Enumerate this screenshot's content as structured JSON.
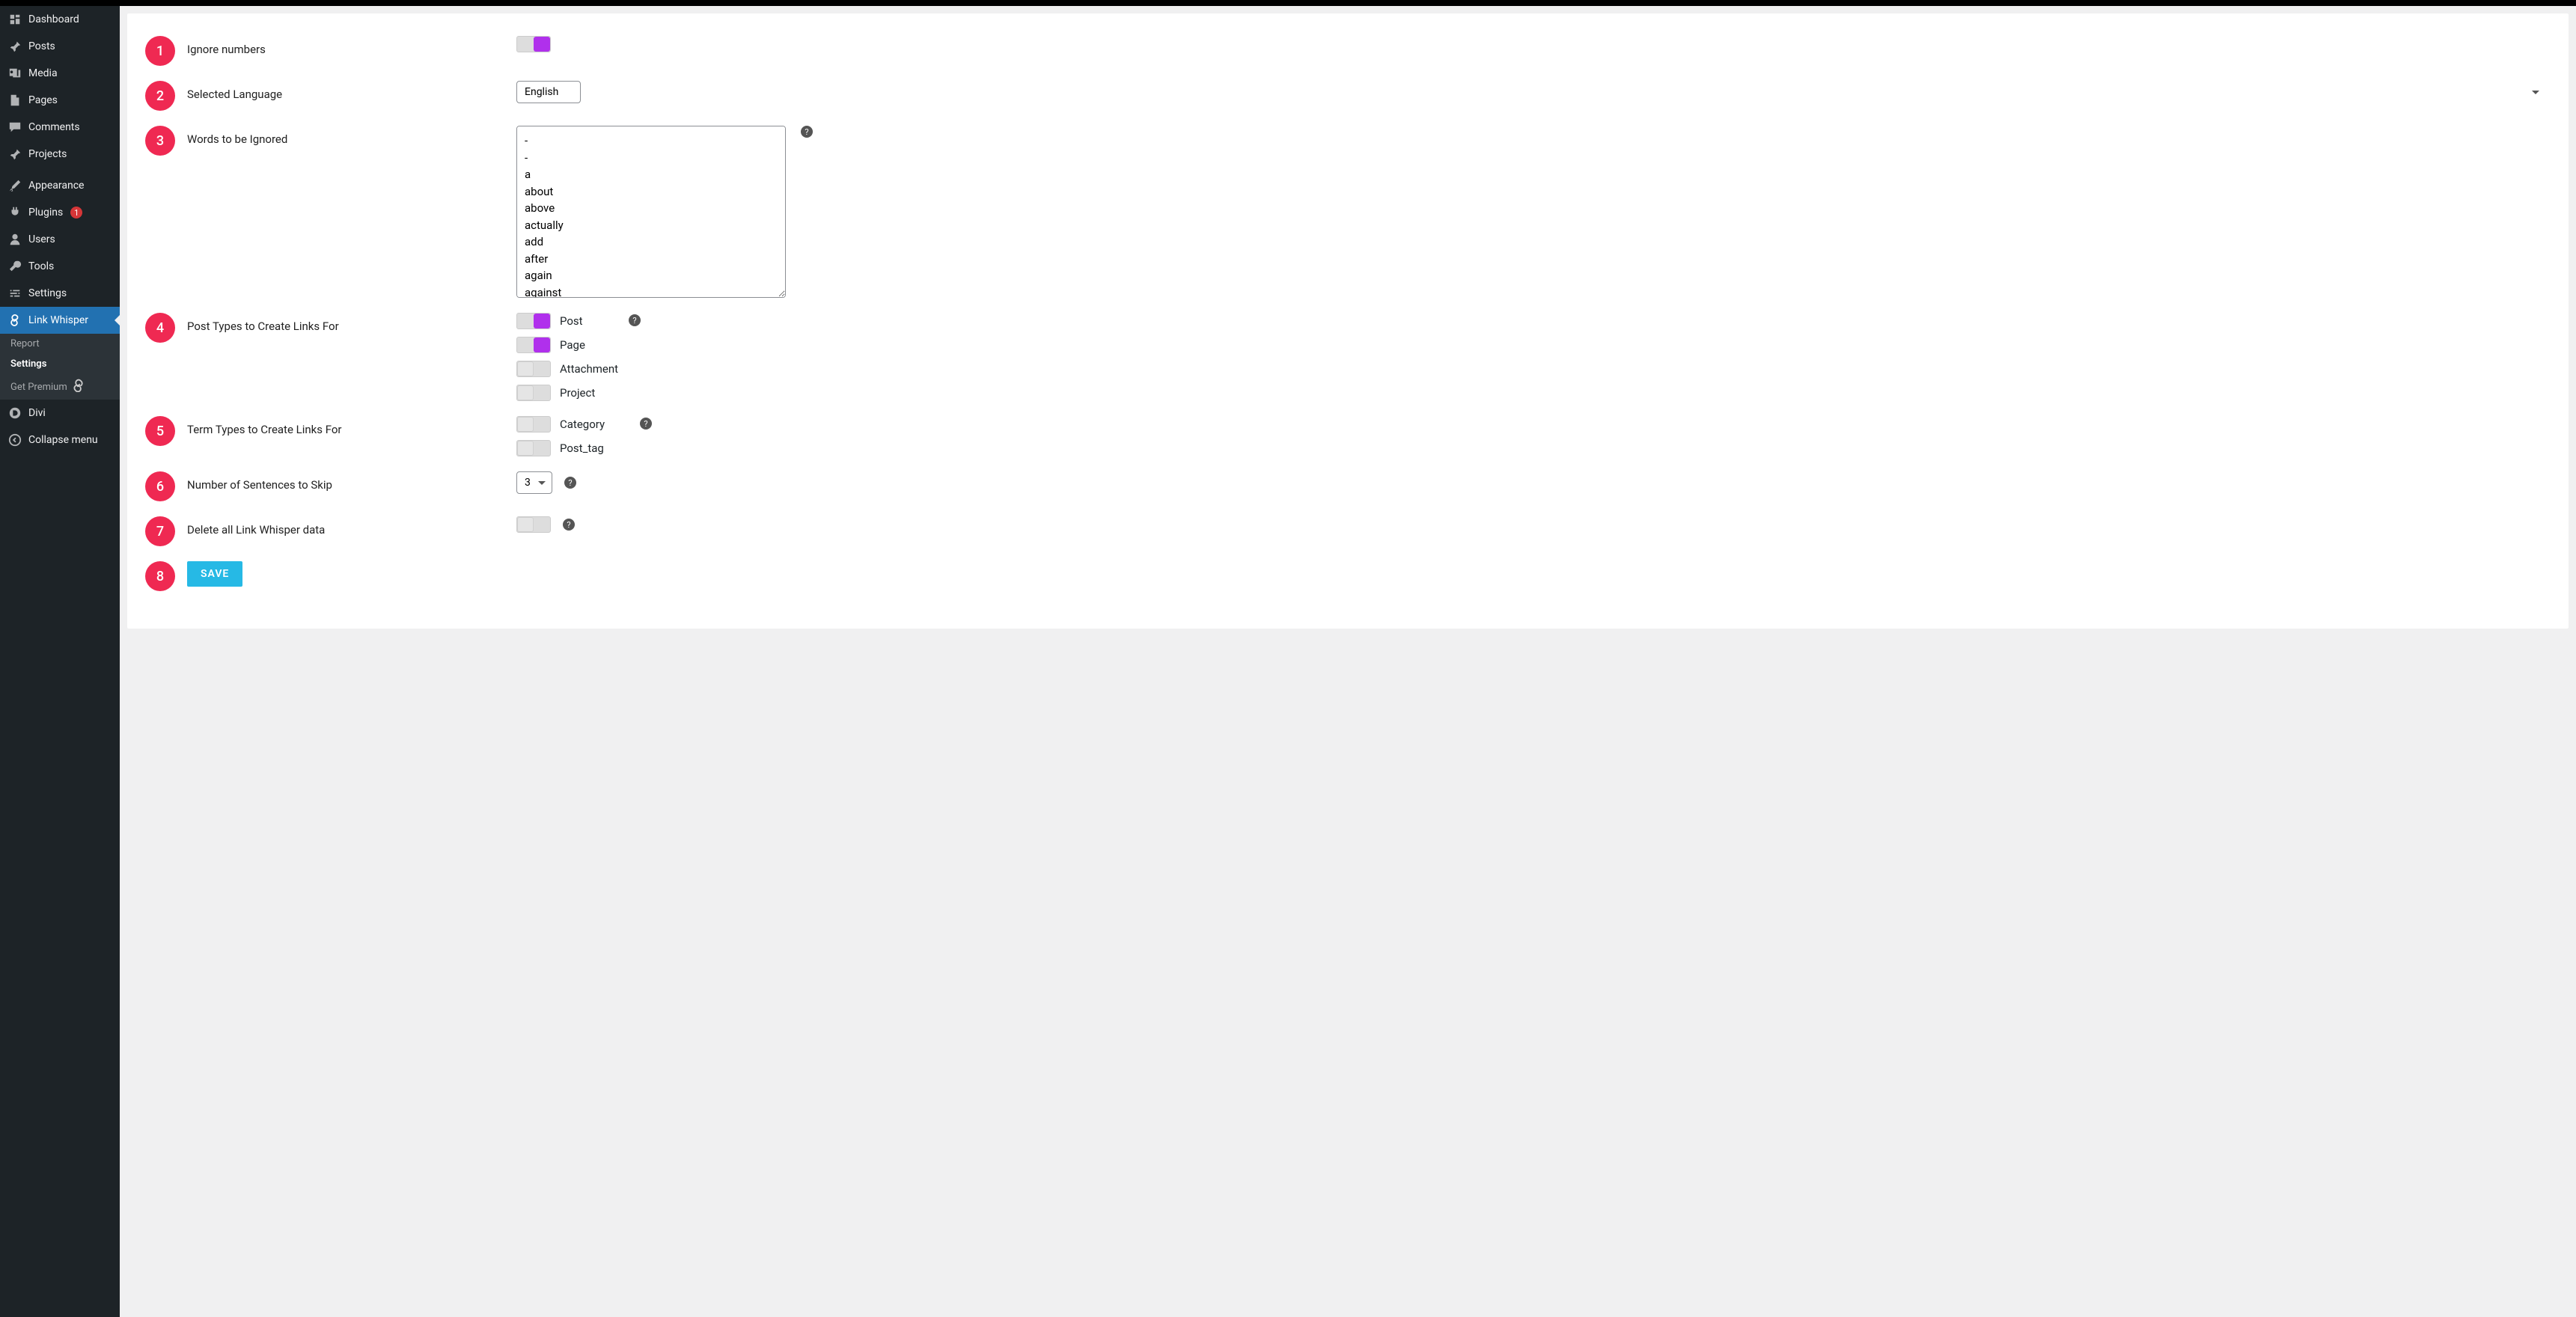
{
  "sidebar": {
    "items": [
      {
        "icon": "dashboard",
        "label": "Dashboard"
      },
      {
        "icon": "pin",
        "label": "Posts"
      },
      {
        "icon": "media",
        "label": "Media"
      },
      {
        "icon": "page",
        "label": "Pages"
      },
      {
        "icon": "comment",
        "label": "Comments"
      },
      {
        "icon": "pin",
        "label": "Projects"
      }
    ],
    "group2": [
      {
        "icon": "brush",
        "label": "Appearance"
      },
      {
        "icon": "plug",
        "label": "Plugins",
        "badge": "1"
      },
      {
        "icon": "user",
        "label": "Users"
      },
      {
        "icon": "wrench",
        "label": "Tools"
      },
      {
        "icon": "settings",
        "label": "Settings"
      }
    ],
    "active": {
      "icon": "link",
      "label": "Link Whisper"
    },
    "subs": [
      {
        "label": "Report"
      },
      {
        "label": "Settings"
      },
      {
        "label": "Get Premium",
        "icon": "link-sm"
      }
    ],
    "group3": [
      {
        "icon": "divi",
        "label": "Divi"
      },
      {
        "icon": "collapse",
        "label": "Collapse menu"
      }
    ]
  },
  "settings": {
    "rows": [
      {
        "n": "1",
        "label": "Ignore numbers"
      },
      {
        "n": "2",
        "label": "Selected Language"
      },
      {
        "n": "3",
        "label": "Words to be Ignored"
      },
      {
        "n": "4",
        "label": "Post Types to Create Links For"
      },
      {
        "n": "5",
        "label": "Term Types to Create Links For"
      },
      {
        "n": "6",
        "label": "Number of Sentences to Skip"
      },
      {
        "n": "7",
        "label": "Delete all Link Whisper data"
      },
      {
        "n": "8",
        "label": ""
      }
    ],
    "language": {
      "value": "English"
    },
    "ignore_words": "-\n-\na\nabout\nabove\nactually\nadd\nafter\nagain\nagainst",
    "post_types": [
      {
        "label": "Post",
        "on": true
      },
      {
        "label": "Page",
        "on": true
      },
      {
        "label": "Attachment",
        "on": false
      },
      {
        "label": "Project",
        "on": false
      }
    ],
    "term_types": [
      {
        "label": "Category",
        "on": false
      },
      {
        "label": "Post_tag",
        "on": false
      }
    ],
    "skip": {
      "value": "3"
    },
    "save_label": "SAVE"
  }
}
